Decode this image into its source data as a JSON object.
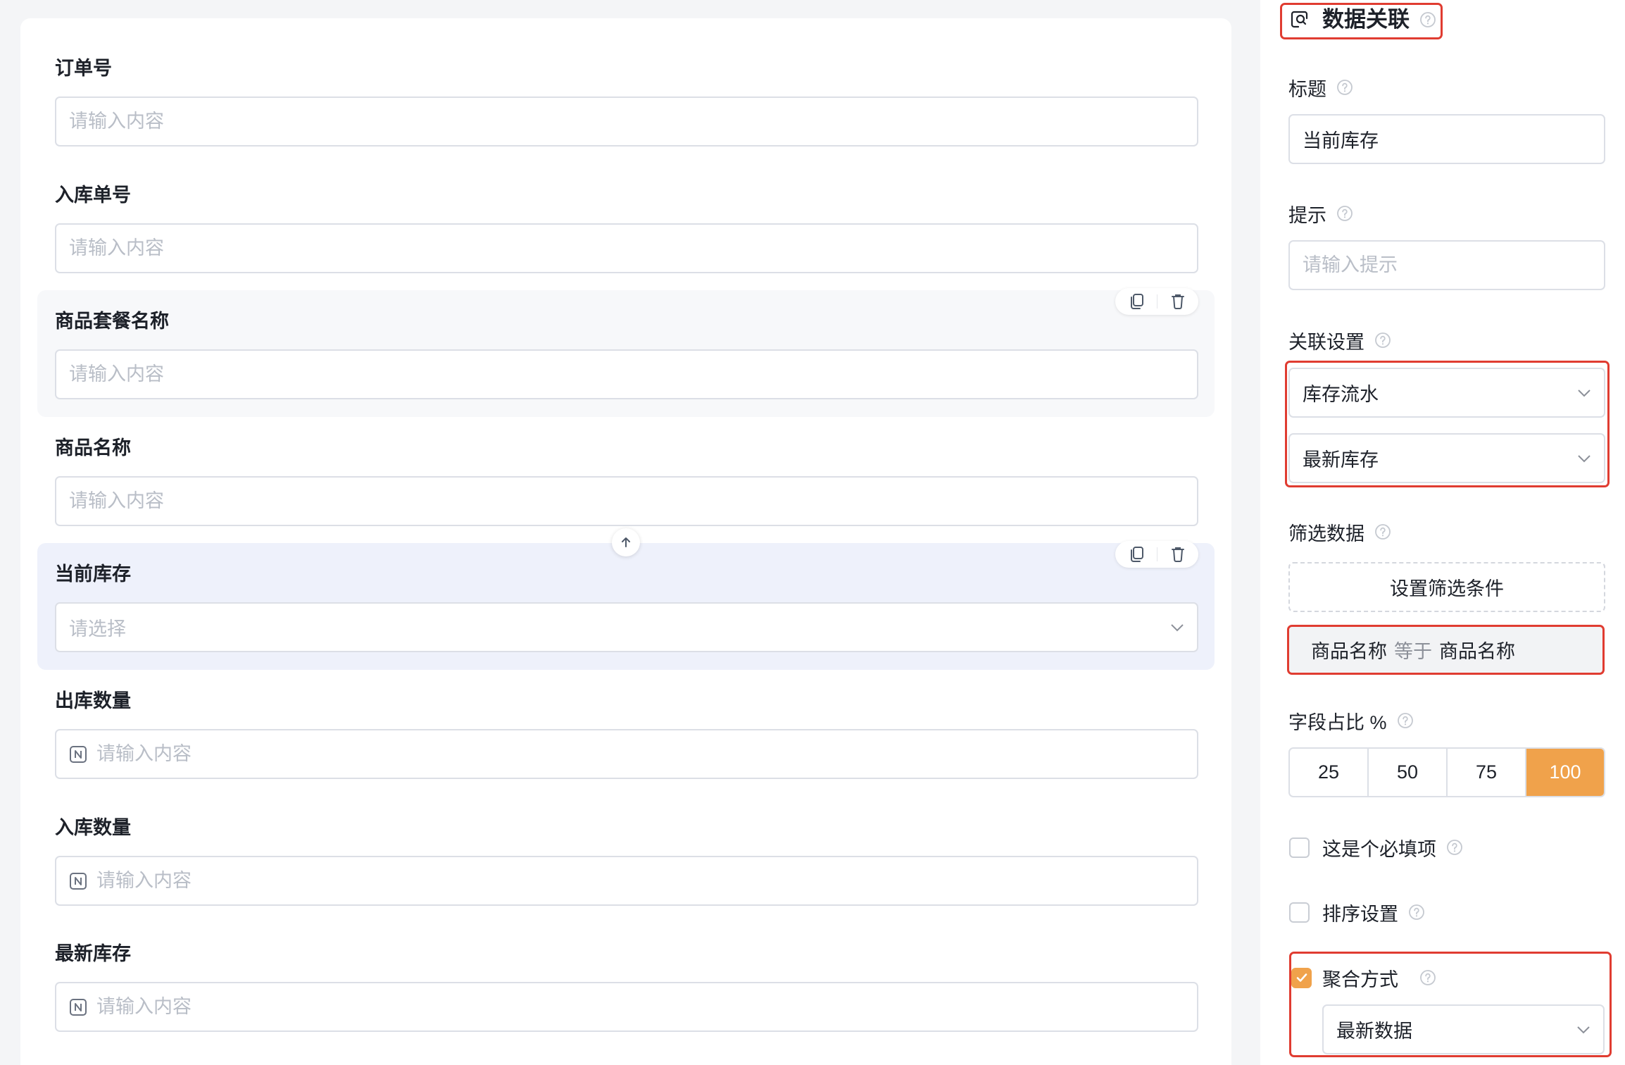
{
  "form": {
    "fields": [
      {
        "label": "订单号",
        "placeholder": "请输入内容"
      },
      {
        "label": "入库单号",
        "placeholder": "请输入内容"
      },
      {
        "label": "商品套餐名称",
        "placeholder": "请输入内容"
      },
      {
        "label": "商品名称",
        "placeholder": "请输入内容"
      },
      {
        "label": "当前库存",
        "placeholder": "请选择",
        "icon": "chevron-down-icon"
      },
      {
        "label": "出库数量",
        "placeholder": "请输入内容",
        "icon": "number-icon"
      },
      {
        "label": "入库数量",
        "placeholder": "请输入内容",
        "icon": "number-icon"
      },
      {
        "label": "最新库存",
        "placeholder": "请输入内容",
        "icon": "number-icon"
      }
    ],
    "hover_field_index": 2,
    "active_field_index": 4,
    "field_tool_icons": [
      "copy-icon",
      "delete-icon"
    ],
    "move_up_icon": "arrow-up-icon"
  },
  "panel": {
    "header": {
      "title": "数据关联",
      "icon": "data-link-icon"
    },
    "title_field": {
      "label": "标题",
      "value": "当前库存"
    },
    "hint_field": {
      "label": "提示",
      "placeholder": "请输入提示"
    },
    "relation": {
      "label": "关联设置",
      "source_table": "库存流水",
      "source_field": "最新库存"
    },
    "filter": {
      "label": "筛选数据",
      "button_label": "设置筛选条件",
      "condition": {
        "field": "商品名称",
        "operator": "等于",
        "value": "商品名称"
      }
    },
    "width_ratio": {
      "label": "字段占比 %",
      "options": [
        "25",
        "50",
        "75",
        "100"
      ],
      "selected_index": 3
    },
    "required": {
      "label": "这是个必填项",
      "checked": false
    },
    "sort": {
      "label": "排序设置",
      "checked": false
    },
    "aggregate": {
      "label": "聚合方式",
      "checked": true,
      "value": "最新数据"
    }
  },
  "colors": {
    "accent": "#f0a24b",
    "annotation_outline": "#e03c31",
    "active_field_bg": "#eef1fb",
    "hover_field_bg": "#f7f8fa"
  }
}
